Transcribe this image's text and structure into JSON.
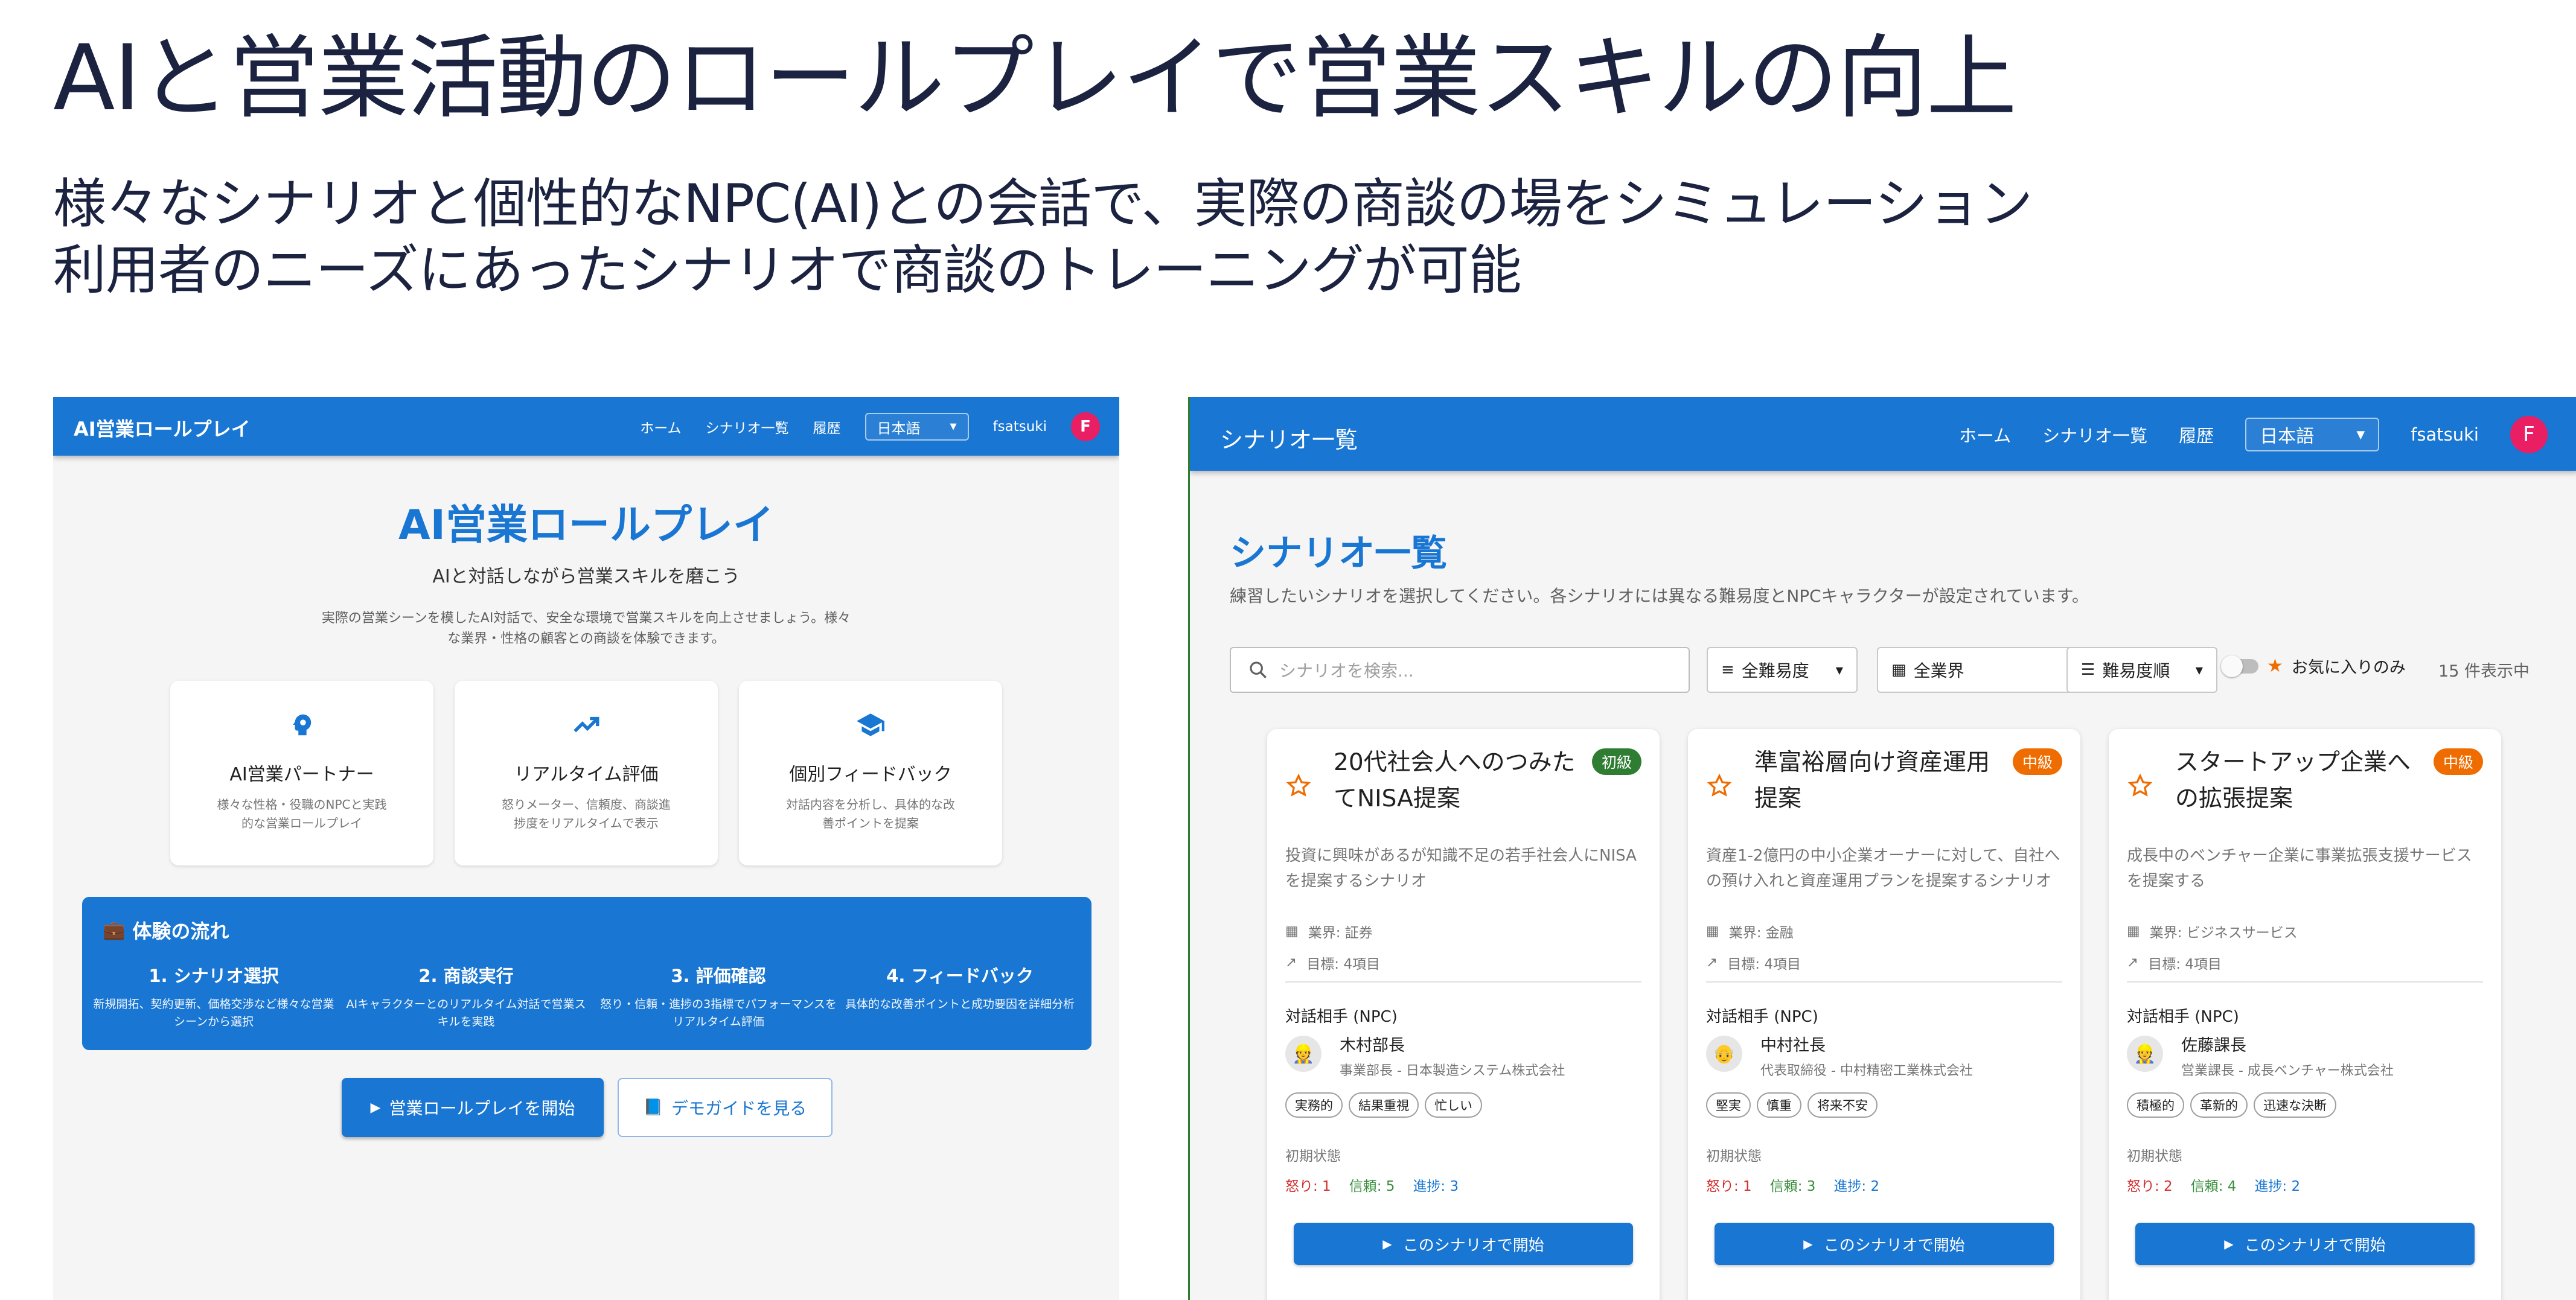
{
  "slide": {
    "title": "AIと営業活動のロールプレイで営業スキルの向上",
    "subtitle_line1": "様々なシナリオと個性的なNPC(AI)との会話で、実際の商談の場をシミュレーション",
    "subtitle_line2": "利用者のニーズにあったシナリオで商談のトレーニングが可能"
  },
  "left": {
    "appbar": {
      "brand": "AI営業ロールプレイ",
      "nav": [
        "ホーム",
        "シナリオ一覧",
        "履歴"
      ],
      "language": "日本語",
      "username": "fsatsuki",
      "avatar_letter": "F"
    },
    "hero": {
      "title": "AI営業ロールプレイ",
      "subtitle": "AIと対話しながら営業スキルを磨こう",
      "description": "実際の営業シーンを模したAI対話で、安全な環境で営業スキルを向上させましょう。様々な業界・性格の顧客との商談を体験できます。"
    },
    "features": [
      {
        "icon": "psychology-icon",
        "title": "AI営業パートナー",
        "desc": "様々な性格・役職のNPCと実践的な営業ロールプレイ"
      },
      {
        "icon": "trending-up-icon",
        "title": "リアルタイム評価",
        "desc": "怒りメーター、信頼度、商談進捗度をリアルタイムで表示"
      },
      {
        "icon": "school-icon",
        "title": "個別フィードバック",
        "desc": "対話内容を分析し、具体的な改善ポイントを提案"
      }
    ],
    "flow": {
      "title": "体験の流れ",
      "icon": "briefcase-icon",
      "steps": [
        {
          "title": "1. シナリオ選択",
          "desc": "新規開拓、契約更新、価格交渉など様々な営業シーンから選択"
        },
        {
          "title": "2. 商談実行",
          "desc": "AIキャラクターとのリアルタイム対話で営業スキルを実践"
        },
        {
          "title": "3. 評価確認",
          "desc": "怒り・信頼・進捗の3指標でパフォーマンスをリアルタイム評価"
        },
        {
          "title": "4. フィードバック",
          "desc": "具体的な改善ポイントと成功要因を詳細分析"
        }
      ]
    },
    "buttons": {
      "start": "営業ロールプレイを開始",
      "demo": "デモガイドを見る"
    }
  },
  "right": {
    "appbar": {
      "brand": "シナリオ一覧",
      "nav": [
        "ホーム",
        "シナリオ一覧",
        "履歴"
      ],
      "language": "日本語",
      "username": "fsatsuki",
      "avatar_letter": "F"
    },
    "page": {
      "title": "シナリオ一覧",
      "description": "練習したいシナリオを選択してください。各シナリオには異なる難易度とNPCキャラクターが設定されています。"
    },
    "filters": {
      "search_placeholder": "シナリオを検索...",
      "difficulty": "全難易度",
      "industry": "全業界",
      "sort": "難易度順",
      "favorites_only": "お気に入りのみ",
      "result_count": "15 件表示中"
    },
    "npc_label": "対話相手 (NPC)",
    "initial_label": "初期状態",
    "start_label": "このシナリオで開始",
    "colors": {
      "beginner": "#2e7d32",
      "intermediate": "#ef6c00",
      "anger": "#d32f2f",
      "trust": "#388e3c",
      "progress": "#1976d2"
    },
    "cards": [
      {
        "title": "20代社会人へのつみたてNISA提案",
        "level": "初級",
        "level_kind": "beginner",
        "desc": "投資に興味があるが知識不足の若手社会人にNISAを提案するシナリオ",
        "industry": "業界: 証券",
        "goals": "目標: 4項目",
        "npc_name": "木村部長",
        "npc_role": "事業部長 - 日本製造システム株式会社",
        "npc_emoji": "👷",
        "tags": [
          "実務的",
          "結果重視",
          "忙しい"
        ],
        "anger": "怒り: 1",
        "trust": "信頼: 5",
        "progress": "進捗: 3"
      },
      {
        "title": "準富裕層向け資産運用提案",
        "level": "中級",
        "level_kind": "intermediate",
        "desc": "資産1-2億円の中小企業オーナーに対して、自社への預け入れと資産運用プランを提案するシナリオ",
        "industry": "業界: 金融",
        "goals": "目標: 4項目",
        "npc_name": "中村社長",
        "npc_role": "代表取締役 - 中村精密工業株式会社",
        "npc_emoji": "👴",
        "tags": [
          "堅実",
          "慎重",
          "将来不安"
        ],
        "anger": "怒り: 1",
        "trust": "信頼: 3",
        "progress": "進捗: 2"
      },
      {
        "title": "スタートアップ企業への拡張提案",
        "level": "中級",
        "level_kind": "intermediate",
        "desc": "成長中のベンチャー企業に事業拡張支援サービスを提案する",
        "industry": "業界: ビジネスサービス",
        "goals": "目標: 4項目",
        "npc_name": "佐藤課長",
        "npc_role": "営業課長 - 成長ベンチャー株式会社",
        "npc_emoji": "👷",
        "tags": [
          "積極的",
          "革新的",
          "迅速な決断"
        ],
        "anger": "怒り: 2",
        "trust": "信頼: 4",
        "progress": "進捗: 2"
      }
    ]
  }
}
